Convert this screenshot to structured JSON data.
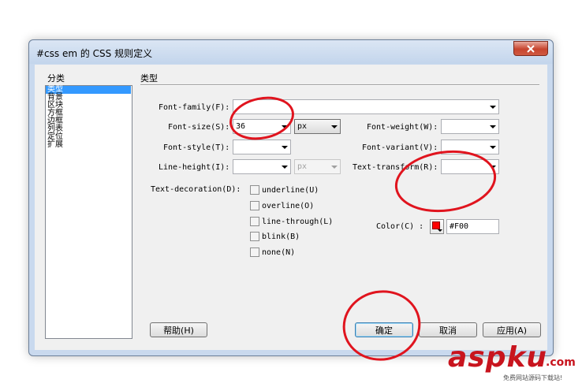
{
  "window": {
    "title": "#css em 的 CSS 规则定义"
  },
  "categories": {
    "label": "分类",
    "items": [
      "类型",
      "背景",
      "区块",
      "方框",
      "边框",
      "列表",
      "定位",
      "扩展"
    ],
    "selected_index": 0
  },
  "section": {
    "title": "类型"
  },
  "fields": {
    "font_family": {
      "label": "Font-family(F):",
      "value": ""
    },
    "font_size": {
      "label": "Font-size(S):",
      "value": "36",
      "unit": "px"
    },
    "font_weight": {
      "label": "Font-weight(W):",
      "value": ""
    },
    "font_style": {
      "label": "Font-style(T):",
      "value": ""
    },
    "font_variant": {
      "label": "Font-variant(V):",
      "value": ""
    },
    "line_height": {
      "label": "Line-height(I):",
      "value": "",
      "unit": "px"
    },
    "text_transform": {
      "label": "Text-transform(R):",
      "value": ""
    },
    "text_decoration": {
      "label": "Text-decoration(D):"
    },
    "color": {
      "label": "Color(C) :",
      "value": "#F00",
      "swatch": "#ff0000"
    }
  },
  "decorations": [
    {
      "label": "underline(U)",
      "checked": false
    },
    {
      "label": "overline(O)",
      "checked": false
    },
    {
      "label": "line-through(L)",
      "checked": false
    },
    {
      "label": "blink(B)",
      "checked": false
    },
    {
      "label": "none(N)",
      "checked": false
    }
  ],
  "buttons": {
    "help": "帮助(H)",
    "ok": "确定",
    "cancel": "取消",
    "apply": "应用(A)"
  },
  "annotation_color": "#e0141e",
  "watermark": {
    "brand": "aspku",
    "domain": ".com",
    "slogan": "免费网站源码下载站!"
  }
}
